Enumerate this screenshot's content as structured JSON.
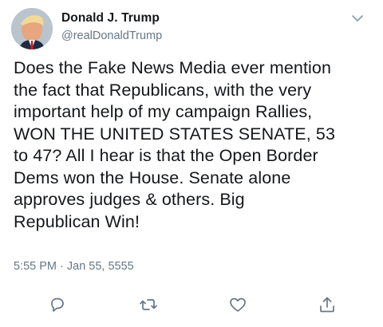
{
  "tweet": {
    "author_name": "Donald J. Trump",
    "author_handle": "@realDonaldTrump",
    "text": "Does the Fake News Media ever mention\nthe fact that Republicans, with the very\nimportant help of my campaign Rallies,\nWON THE UNITED STATES SENATE, 53\nto 47? All I hear is that the Open Border\nDems won the House. Senate alone\napproves judges & others. Big\nRepublican Win!",
    "timestamp": "5:55 PM · Jan 55, 5555"
  },
  "icons": {
    "menu": "chevron-down-icon",
    "reply": "reply-icon",
    "retweet": "retweet-icon",
    "like": "like-icon",
    "share": "share-icon"
  },
  "colors": {
    "text": "#14171a",
    "secondary": "#657786",
    "icon": "#657786",
    "background": "#ffffff"
  }
}
